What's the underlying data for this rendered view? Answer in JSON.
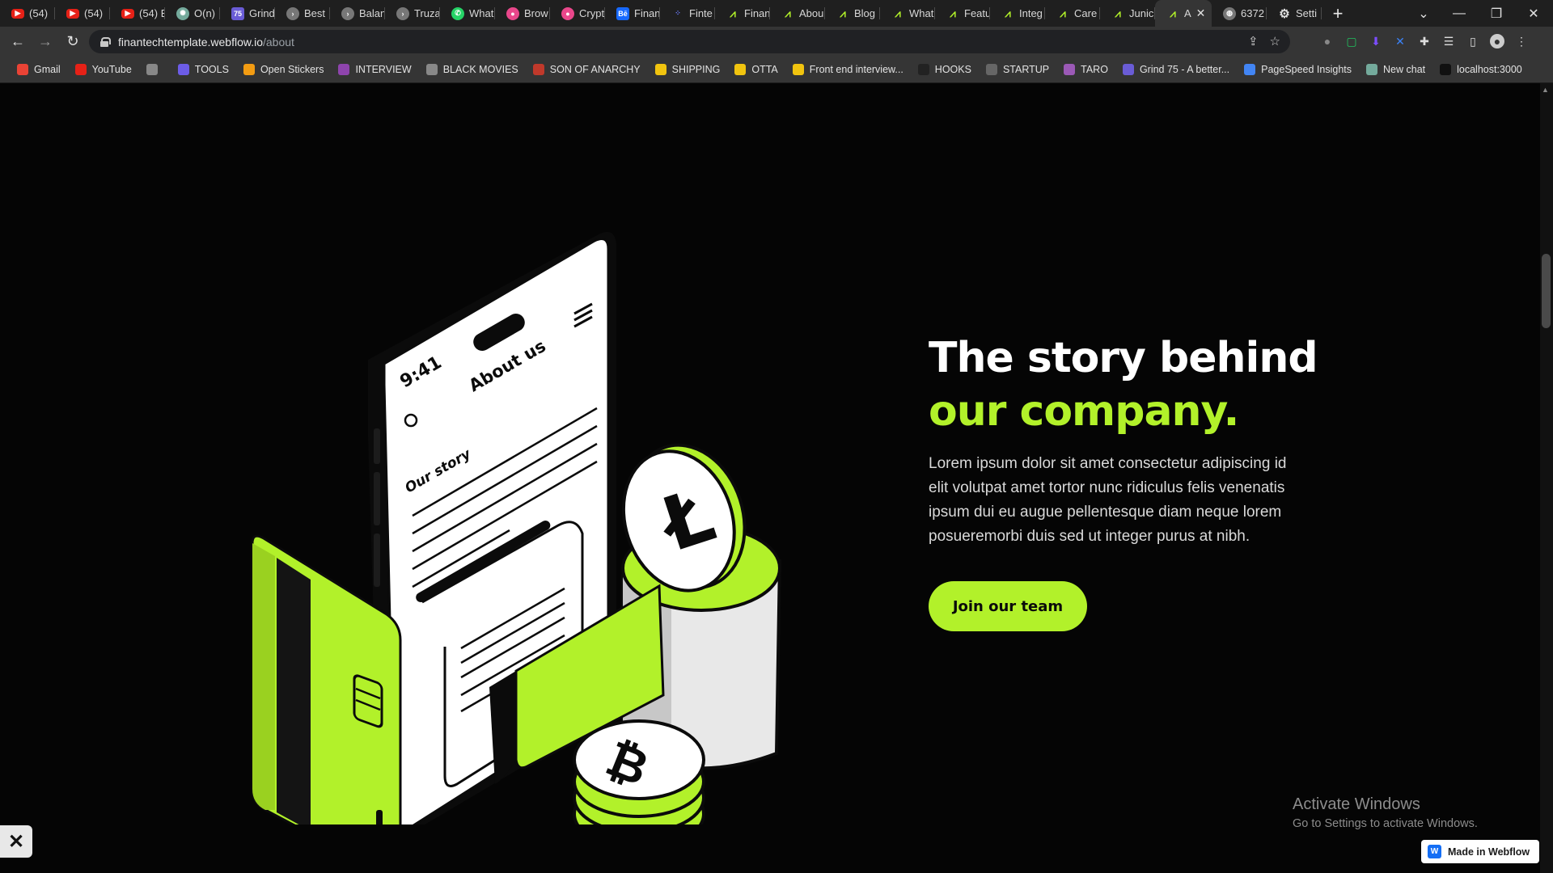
{
  "tabs": [
    {
      "label": "(54) ",
      "icon": "youtube"
    },
    {
      "label": "(54) ",
      "icon": "youtube"
    },
    {
      "label": "(54) E",
      "icon": "youtube"
    },
    {
      "label": "O(n)",
      "icon": "chatgpt"
    },
    {
      "label": "Grind",
      "icon": "grind75"
    },
    {
      "label": "Best ",
      "icon": "generic"
    },
    {
      "label": "Balan",
      "icon": "generic"
    },
    {
      "label": "Truza",
      "icon": "generic"
    },
    {
      "label": "What",
      "icon": "whatsapp"
    },
    {
      "label": "Brow",
      "icon": "dribbble"
    },
    {
      "label": "Crypt",
      "icon": "dribbble"
    },
    {
      "label": "Finan",
      "icon": "behance"
    },
    {
      "label": "Finte",
      "icon": "dots"
    },
    {
      "label": "Finan",
      "icon": "finantech"
    },
    {
      "label": "Abou",
      "icon": "finantech"
    },
    {
      "label": "Blog",
      "icon": "finantech"
    },
    {
      "label": "What",
      "icon": "finantech"
    },
    {
      "label": "Featu",
      "icon": "finantech"
    },
    {
      "label": "Integ",
      "icon": "finantech"
    },
    {
      "label": "Care",
      "icon": "finantech"
    },
    {
      "label": "Junic",
      "icon": "finantech"
    },
    {
      "label": "A",
      "icon": "finantech",
      "active": true
    },
    {
      "label": "6372",
      "icon": "globe"
    },
    {
      "label": "Setti",
      "icon": "gear"
    }
  ],
  "address": {
    "host": "finantechtemplate.webflow.io",
    "path": "/about"
  },
  "bookmarks": [
    {
      "label": "Gmail",
      "color": "#ea4335"
    },
    {
      "label": "YouTube",
      "color": "#e62117"
    },
    {
      "label": "",
      "color": "#888888"
    },
    {
      "label": "TOOLS",
      "color": "#6c5ce7"
    },
    {
      "label": "Open Stickers",
      "color": "#f39c12"
    },
    {
      "label": "INTERVIEW",
      "color": "#8e44ad"
    },
    {
      "label": "BLACK MOVIES",
      "color": "#888888"
    },
    {
      "label": "SON OF ANARCHY",
      "color": "#c0392b"
    },
    {
      "label": "SHIPPING",
      "color": "#f1c40f"
    },
    {
      "label": "OTTA",
      "color": "#f1c40f"
    },
    {
      "label": "Front end interview...",
      "color": "#f1c40f"
    },
    {
      "label": "HOOKS",
      "color": "#222222"
    },
    {
      "label": "STARTUP",
      "color": "#666666"
    },
    {
      "label": "TARO",
      "color": "#9b59b6"
    },
    {
      "label": "Grind 75 - A better...",
      "color": "#6a5cd6"
    },
    {
      "label": "PageSpeed Insights",
      "color": "#4285f4"
    },
    {
      "label": "New chat",
      "color": "#74aa9c"
    },
    {
      "label": "localhost:3000",
      "color": "#111111"
    }
  ],
  "hero": {
    "headline_line1": "The story behind",
    "headline_line2": "our company.",
    "body": "Lorem ipsum dolor sit amet consectetur adipiscing  id elit volutpat amet tortor nunc ridiculus felis venenatis ipsum dui eu augue pellentesque diam neque  lorem posueremorbi duis sed ut integer purus at nibh.",
    "cta_label": "Join our team",
    "phone_time": "9:41",
    "phone_title": "About us",
    "phone_section": "Our story"
  },
  "watermark": {
    "title": "Activate Windows",
    "subtitle": "Go to Settings to activate Windows."
  },
  "badge": {
    "label": "Made in Webflow"
  },
  "colors": {
    "accent": "#b2f12a",
    "background": "#050505",
    "text": "#ffffff"
  }
}
